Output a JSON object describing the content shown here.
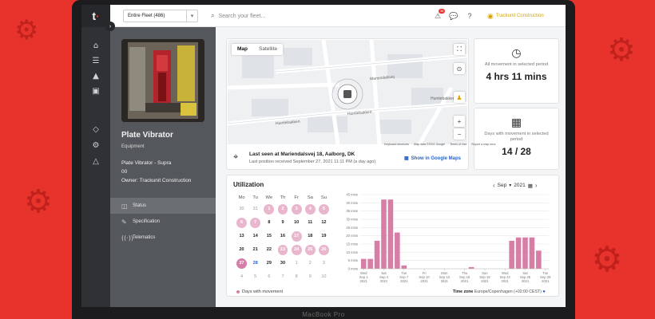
{
  "topbar": {
    "fleet_select": "Entire Fleet (486)",
    "search_placeholder": "Search your fleet...",
    "notification_count": "36",
    "account_name": "Trackunit Construction",
    "icons": [
      "alert-icon",
      "chat-icon",
      "help-icon",
      "user-icon"
    ]
  },
  "rail": {
    "icons": [
      "home-icon",
      "list-icon",
      "machine-icon",
      "report-icon",
      "box-icon",
      "service-icon",
      "cone-icon"
    ]
  },
  "asset": {
    "name": "Plate Vibrator",
    "category": "Equipment",
    "model": "Plate Vibrator - Supra",
    "number": "00",
    "owner": "Owner: Trackunit Construction",
    "nav": [
      {
        "label": "Status",
        "icon": "status-icon",
        "active": true
      },
      {
        "label": "Specification",
        "icon": "edit-icon",
        "active": false
      },
      {
        "label": "Telematics",
        "icon": "signal-icon",
        "active": false
      }
    ]
  },
  "map": {
    "tabs": [
      "Map",
      "Satellite"
    ],
    "streets": [
      "Humlebakken",
      "Humlebakken",
      "Humlebakken",
      "Mariendalsvej"
    ],
    "footer": [
      "Keyboard shortcuts",
      "Map data ©2021 Google",
      "Terms of Use",
      "Report a map error"
    ],
    "last_seen": "Last seen at Mariendalsvej 18, Aalborg, DK",
    "last_position": "Last position received September 27, 2021 11:11 PM (a day ago)",
    "gmaps_link": "Show in Google Maps"
  },
  "stats": [
    {
      "icon": "clock-icon",
      "label": "All movement in selected period",
      "value": "4 hrs 11 mins"
    },
    {
      "icon": "calendar-icon",
      "label": "Days with movement in selected period",
      "value": "14 / 28"
    }
  ],
  "utilization": {
    "title": "Utilization",
    "month": "Sep",
    "year": "2021",
    "weekdays": [
      "Mo",
      "Tu",
      "We",
      "Th",
      "Fr",
      "Sa",
      "Su"
    ],
    "calendar": [
      [
        {
          "d": "30",
          "s": "muted"
        },
        {
          "d": "31",
          "s": "muted"
        },
        {
          "d": "1",
          "s": "mv light"
        },
        {
          "d": "2",
          "s": "mv light"
        },
        {
          "d": "3",
          "s": "mv light"
        },
        {
          "d": "4",
          "s": "mv light"
        },
        {
          "d": "5",
          "s": "mv light"
        }
      ],
      [
        {
          "d": "6",
          "s": "mv light"
        },
        {
          "d": "7",
          "s": "mv light"
        },
        {
          "d": "8",
          "s": "bold"
        },
        {
          "d": "9",
          "s": "bold"
        },
        {
          "d": "10",
          "s": "bold"
        },
        {
          "d": "11",
          "s": "bold"
        },
        {
          "d": "12",
          "s": "bold"
        }
      ],
      [
        {
          "d": "13",
          "s": "bold"
        },
        {
          "d": "14",
          "s": "bold"
        },
        {
          "d": "15",
          "s": "bold"
        },
        {
          "d": "16",
          "s": "bold"
        },
        {
          "d": "17",
          "s": "mv light"
        },
        {
          "d": "18",
          "s": "bold"
        },
        {
          "d": "19",
          "s": "bold"
        }
      ],
      [
        {
          "d": "20",
          "s": "bold"
        },
        {
          "d": "21",
          "s": "bold"
        },
        {
          "d": "22",
          "s": "bold"
        },
        {
          "d": "23",
          "s": "mv light"
        },
        {
          "d": "24",
          "s": "mv light"
        },
        {
          "d": "25",
          "s": "mv light"
        },
        {
          "d": "26",
          "s": "mv light"
        }
      ],
      [
        {
          "d": "27",
          "s": "mv"
        },
        {
          "d": "28",
          "s": "today"
        },
        {
          "d": "29",
          "s": "bold"
        },
        {
          "d": "30",
          "s": "bold"
        },
        {
          "d": "1",
          "s": "muted"
        },
        {
          "d": "2",
          "s": "muted"
        },
        {
          "d": "3",
          "s": "muted"
        }
      ],
      [
        {
          "d": "4",
          "s": "muted"
        },
        {
          "d": "5",
          "s": "muted"
        },
        {
          "d": "6",
          "s": "muted"
        },
        {
          "d": "7",
          "s": "muted"
        },
        {
          "d": "8",
          "s": "muted"
        },
        {
          "d": "9",
          "s": "muted"
        },
        {
          "d": "10",
          "s": "muted"
        }
      ]
    ],
    "legend": "Days with movement",
    "timezone_label": "Time zone",
    "timezone_value": "Europe/Copenhagen (+02:00 CEST)"
  },
  "chart_data": {
    "type": "bar",
    "color": "#d77ea7",
    "ylim": [
      0,
      45
    ],
    "yticks": [
      0,
      5,
      10,
      15,
      20,
      25,
      30,
      35,
      40,
      45
    ],
    "ytick_labels": [
      "0 mins",
      "5 mins",
      "10 mins",
      "15 mins",
      "20 mins",
      "25 mins",
      "30 mins",
      "35 mins",
      "40 mins",
      "45 mins"
    ],
    "xtick_labels": [
      [
        "Wed",
        "Sep 1",
        "2021"
      ],
      [
        "Sat",
        "Sep 4",
        "2021"
      ],
      [
        "Tue",
        "Sep 7",
        "2021"
      ],
      [
        "Fri",
        "Sep 10",
        "2021"
      ],
      [
        "Mon",
        "Sep 13",
        "2021"
      ],
      [
        "Thu",
        "Sep 16",
        "2021"
      ],
      [
        "Sun",
        "Sep 19",
        "2021"
      ],
      [
        "Wed",
        "Sep 22",
        "2021"
      ],
      [
        "Sat",
        "Sep 25",
        "2021"
      ],
      [
        "Tue",
        "Sep 28",
        "2021"
      ]
    ],
    "categories": [
      "Sep 1",
      "Sep 2",
      "Sep 3",
      "Sep 4",
      "Sep 5",
      "Sep 6",
      "Sep 7",
      "Sep 8",
      "Sep 9",
      "Sep 10",
      "Sep 11",
      "Sep 12",
      "Sep 13",
      "Sep 14",
      "Sep 15",
      "Sep 16",
      "Sep 17",
      "Sep 18",
      "Sep 19",
      "Sep 20",
      "Sep 21",
      "Sep 22",
      "Sep 23",
      "Sep 24",
      "Sep 25",
      "Sep 26",
      "Sep 27",
      "Sep 28"
    ],
    "values": [
      6,
      6,
      17,
      42,
      42,
      22,
      2,
      0,
      0,
      0,
      0,
      0,
      0,
      0,
      0,
      0,
      1,
      0,
      0,
      0,
      0,
      0,
      17,
      19,
      19,
      19,
      11,
      0
    ]
  }
}
